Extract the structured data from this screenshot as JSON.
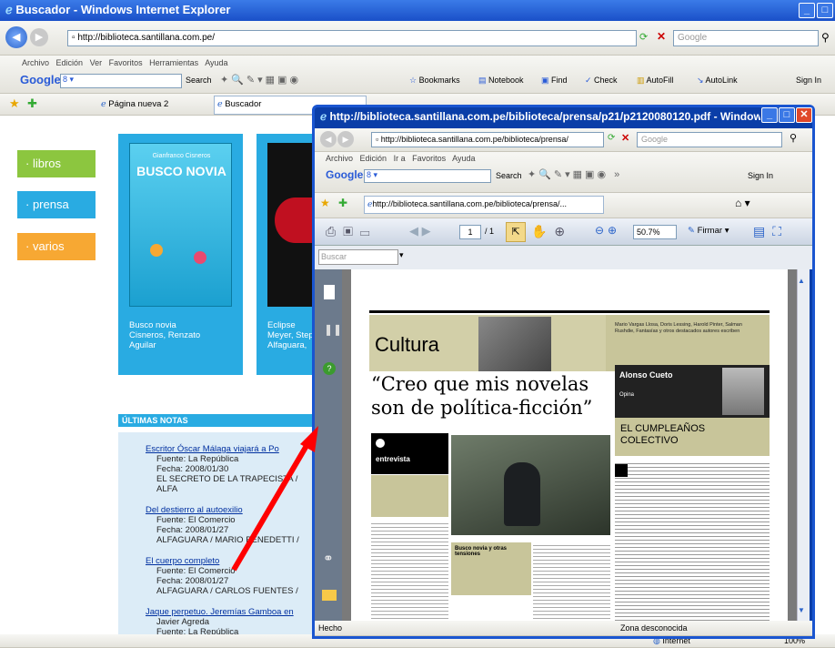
{
  "main_window": {
    "title": "Buscador - Windows Internet Explorer",
    "address": "http://biblioteca.santillana.com.pe/",
    "search_placeholder": "Google",
    "menu": [
      "Archivo",
      "Edición",
      "Ver",
      "Favoritos",
      "Herramientas",
      "Ayuda"
    ],
    "google_toolbar": {
      "label": "Google",
      "search": "Search",
      "bookmarks": "Bookmarks",
      "notebook": "Notebook",
      "find": "Find",
      "check": "Check",
      "autofill": "AutoFill",
      "autolink": "AutoLink",
      "signin": "Sign In"
    },
    "tabs": [
      "Página nueva 2",
      "Buscador"
    ],
    "status_internet": "Internet",
    "zoom": "100%"
  },
  "site": {
    "nav": [
      {
        "label": "libros",
        "color": "#8cc63f"
      },
      {
        "label": "prensa",
        "color": "#29abe2"
      },
      {
        "label": "varios",
        "color": "#f7a833"
      }
    ],
    "books": [
      {
        "cover_title": "BUSCO NOVIA",
        "cover_author": "Gianfranco Cisneros",
        "caption": [
          "Busco novia",
          "Cisneros, Renzato",
          "Aguilar"
        ]
      },
      {
        "caption": [
          "Eclipse",
          "Meyer, Step",
          "Alfaguara,"
        ]
      }
    ],
    "notes_header": "ÚLTIMAS NOTAS",
    "notes": [
      {
        "title": "Escritor Óscar Málaga viajará a Po",
        "lines": [
          "Fuente: La República",
          "Fecha: 2008/01/30",
          "EL SECRETO DE LA TRAPECISTA / ALFA"
        ]
      },
      {
        "title": "Del destierro al autoexilio",
        "lines": [
          "Fuente: El Comercio",
          "Fecha: 2008/01/27",
          "ALFAGUARA / MARIO BENEDETTI /"
        ]
      },
      {
        "title": "El cuerpo completo",
        "lines": [
          "Fuente: El Comercio",
          "Fecha: 2008/01/27",
          "ALFAGUARA / CARLOS FUENTES /"
        ]
      },
      {
        "title": "Jaque perpetuo. Jeremías Gamboa en",
        "lines": [
          "Javier Agreda",
          "Fuente: La República"
        ]
      }
    ]
  },
  "pdf_window": {
    "title": "http://biblioteca.santillana.com.pe/biblioteca/prensa/p21/p2120080120.pdf - Windows Int...",
    "address": "http://biblioteca.santillana.com.pe/biblioteca/prensa/",
    "menu": [
      "Archivo",
      "Edición",
      "Ir a",
      "Favoritos",
      "Ayuda"
    ],
    "tab": "http://biblioteca.santillana.com.pe/biblioteca/prensa/...",
    "page": "1",
    "pages": "/ 1",
    "zoom": "50.7%",
    "sign": "Firmar",
    "search": "Buscar",
    "status_left": "Hecho",
    "status_zone": "Zona desconocida"
  },
  "newspaper": {
    "section": "Cultura",
    "headline_1": "“Creo que mis novelas",
    "headline_2": "son de política-ficción”",
    "columnist": "Alonso Cueto",
    "columnist_role": "Opina",
    "column_title_1": "EL CUMPLEAÑOS",
    "column_title_2": "COLECTIVO",
    "interview_label": "entrevista",
    "top_teaser": "Mario Vargas Llosa, Doris Lessing, Harold Pinter, Salman Rushdie, Fantasías y otros destacados autores escriben",
    "quote_box": "Busco novia y otras tensiones"
  }
}
